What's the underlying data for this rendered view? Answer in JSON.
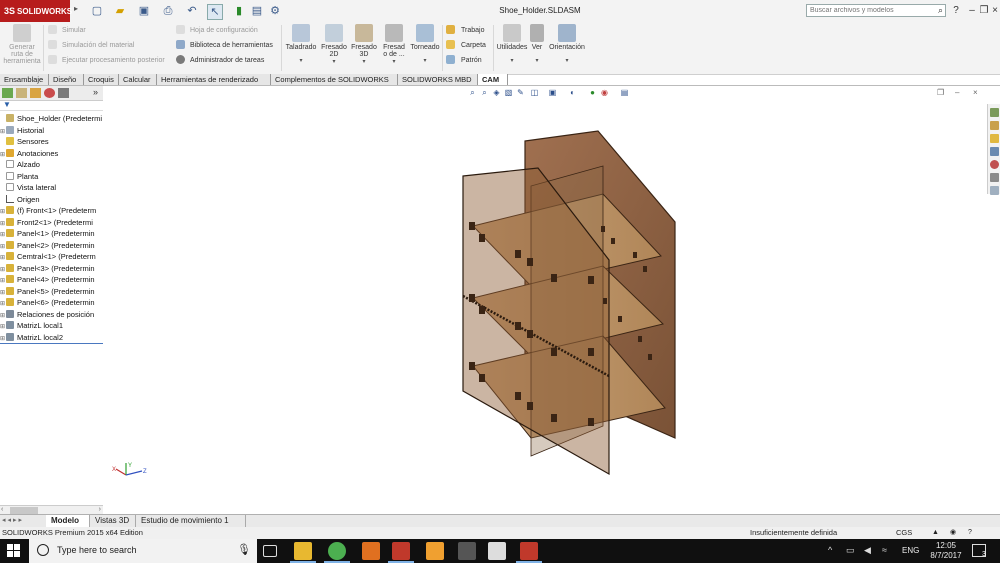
{
  "app": {
    "logo_text": "SOLIDWORKS",
    "logo_mark": "3S",
    "document_title": "Shoe_Holder.SLDASM",
    "search_placeholder": "Buscar archivos y modelos",
    "status_edition": "SOLIDWORKS Premium 2015 x64 Edition",
    "status_definition": "Insuficientemente definida",
    "status_units": "CGS",
    "brand_color": "#b71c1c"
  },
  "quick_access": {
    "icons": [
      "new-document-icon",
      "open-icon",
      "save-icon",
      "print-icon",
      "undo-icon",
      "select-pointer-icon",
      "rebuild-icon",
      "file-properties-icon",
      "options-icon"
    ]
  },
  "ribbon": {
    "generate_label_1": "Generar",
    "generate_label_2": "ruta de",
    "generate_label_3": "herramienta",
    "simulate_label": "Simular",
    "material_sim_label": "Simulación del material",
    "post_label": "Ejecutar procesamiento posterior",
    "config_sheet_label": "Hoja de configuración",
    "tool_library_label": "Biblioteca de herramientas",
    "task_admin_label": "Administrador de tareas",
    "ops": [
      "Taladrado",
      "Fresado\n2D",
      "Fresado\n3D",
      "Fresad\no de ...",
      "Torneado"
    ],
    "op_1": "Taladrado",
    "op_2a": "Fresado",
    "op_2b": "2D",
    "op_3a": "Fresado",
    "op_3b": "3D",
    "op_4a": "Fresad",
    "op_4b": "o de ...",
    "op_5": "Torneado",
    "job_label": "Trabajo",
    "folder_label": "Carpeta",
    "pattern_label": "Patrón",
    "utilities_label": "Utilidades",
    "view_label": "Ver",
    "orientation_label": "Orientación"
  },
  "command_tabs": [
    {
      "label": "Ensamblaje"
    },
    {
      "label": "Diseño"
    },
    {
      "label": "Croquis"
    },
    {
      "label": "Calcular"
    },
    {
      "label": "Herramientas de renderizado"
    },
    {
      "label": "Complementos de SOLIDWORKS"
    },
    {
      "label": "SOLIDWORKS MBD"
    },
    {
      "label": "CAM"
    }
  ],
  "tree": {
    "root": "Shoe_Holder  (Predetermi",
    "items": [
      "Historial",
      "Sensores",
      "Anotaciones",
      "Alzado",
      "Planta",
      "Vista lateral",
      "Origen",
      "(f) Front<1> (Predeterm",
      "Front2<1> (Predetermi",
      "Panel<1> (Predetermin",
      "Panel<2> (Predetermin",
      "Cemtral<1> (Predeterm",
      "Panel<3> (Predetermin",
      "Panel<4> (Predetermin",
      "Panel<5> (Predetermin",
      "Panel<6> (Predetermin",
      "Relaciones de posición",
      "MatrizL local1",
      "MatrizL local2"
    ]
  },
  "bottom_tabs": [
    "Modelo",
    "Vistas 3D",
    "Estudio de movimiento 1"
  ],
  "taskbar": {
    "search_placeholder": "Type here to search",
    "language": "ENG",
    "time": "12:05",
    "date": "8/7/2017",
    "notifications": "3"
  },
  "triad": {
    "x": "X",
    "y": "Y",
    "z": "Z"
  }
}
